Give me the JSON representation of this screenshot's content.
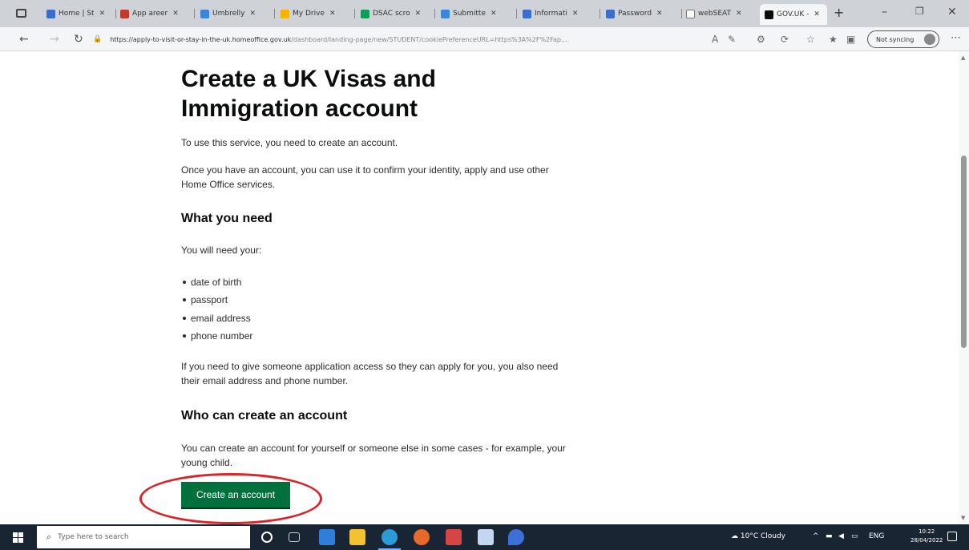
{
  "browser": {
    "tabs": [
      {
        "label": "Home | St",
        "color": "#3b6ec9"
      },
      {
        "label": "App areer",
        "color": "#c0392b"
      },
      {
        "label": "Umbrelly",
        "color": "#3a87d9"
      },
      {
        "label": "My Drive",
        "color": "#f4b400"
      },
      {
        "label": "DSAC scro",
        "color": "#0f9d58"
      },
      {
        "label": "Submitte",
        "color": "#3a87d9"
      },
      {
        "label": "Informati",
        "color": "#3b6ec9"
      },
      {
        "label": "Password",
        "color": "#3b6ec9"
      },
      {
        "label": "webSEAT",
        "color": "#888888"
      },
      {
        "label": "GOV.UK -",
        "color": "#0b0c0c"
      }
    ],
    "url_host": "https://apply-to-visit-or-stay-in-the-uk.homeoffice.gov.uk",
    "url_path": "/dashboard/landing-page/new/STUDENT/cookiePreferenceURL=https%3A%2F%2Fap...",
    "sync_label": "Not syncing",
    "icons": {
      "back": "back-arrow-icon",
      "forward": "forward-arrow-icon",
      "refresh": "refresh-icon"
    }
  },
  "page": {
    "title": "Create a UK Visas and Immigration account",
    "intro": "To use this service, you need to create an account.",
    "intro2": "Once you have an account, you can use it to confirm your identity, apply and use other Home Office services.",
    "need_heading": "What you need",
    "need_lead": "You will need your:",
    "need_items": [
      "date of birth",
      "passport",
      "email address",
      "phone number"
    ],
    "access_text": "If you need to give someone application access so they can apply for you, you also need their email address and phone number.",
    "who_heading": "Who can create an account",
    "who_text": "You can create an account for yourself or someone else in some cases - for example, your young child.",
    "create_button": "Create an account"
  },
  "taskbar": {
    "search_placeholder": "Type here to search",
    "weather": "10°C Cloudy",
    "lang": "ENG",
    "time": "10:22",
    "date": "28/04/2022"
  },
  "colors": {
    "govuk_green": "#00703c",
    "highlight_red": "#d9252a",
    "taskbar": "#1a2533"
  }
}
